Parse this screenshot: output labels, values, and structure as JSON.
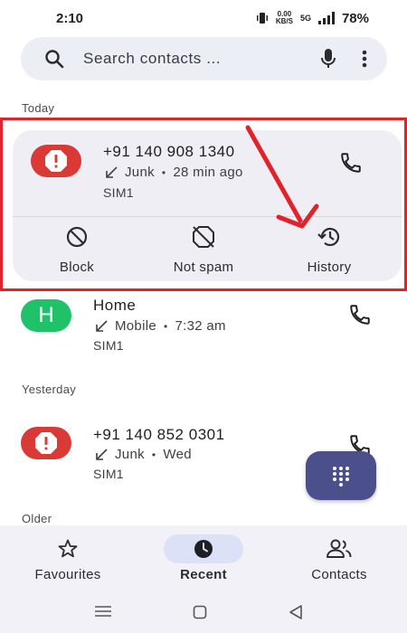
{
  "status_bar": {
    "time": "2:10",
    "net_speed_value": "0.00",
    "net_speed_unit": "KB/S",
    "network_type": "5G",
    "battery": "78%"
  },
  "search": {
    "placeholder": "Search contacts ..."
  },
  "sections": {
    "today": "Today",
    "yesterday": "Yesterday",
    "older": "Older"
  },
  "calls": [
    {
      "number": "+91 140 908 1340",
      "type": "Junk",
      "time": "28 min ago",
      "sim": "SIM1",
      "avatar": "spam-icon"
    },
    {
      "number": "Home",
      "type": "Mobile",
      "time": "7:32 am",
      "sim": "SIM1",
      "avatar_letter": "H",
      "avatar_color": "#1fc269"
    },
    {
      "number": "+91 140 852 0301",
      "type": "Junk",
      "time": "Wed",
      "sim": "SIM1",
      "avatar": "spam-icon"
    }
  ],
  "separator": "•",
  "actions": {
    "block": "Block",
    "not_spam": "Not spam",
    "history": "History"
  },
  "bottom_nav": {
    "favourites": "Favourites",
    "recent": "Recent",
    "contacts": "Contacts"
  },
  "colors": {
    "accent": "#4b4f8c",
    "spam": "#d93a36",
    "highlight": "#e2222a",
    "nav_active": "#dde1f8"
  }
}
